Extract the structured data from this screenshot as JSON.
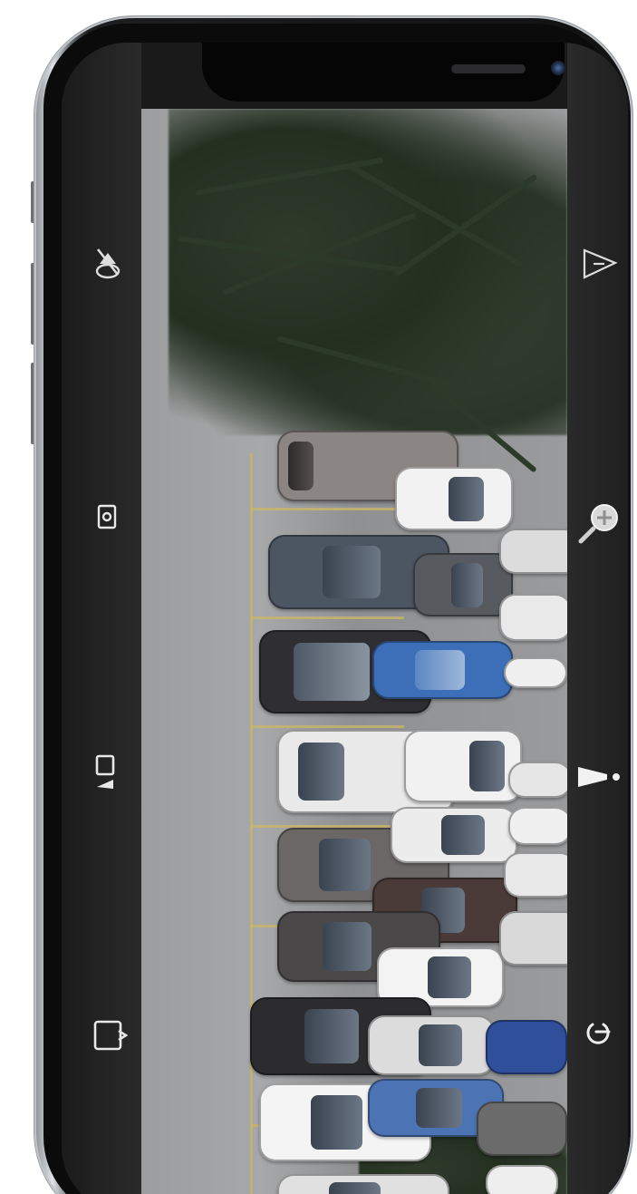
{
  "device": {
    "type": "smartphone",
    "orientation": "landscape-ui-in-portrait-frame"
  },
  "video": {
    "scene": "parking-lot-aerial"
  },
  "controls": {
    "left": [
      {
        "name": "audio-off-icon"
      },
      {
        "name": "snapshot-icon"
      },
      {
        "name": "record-icon"
      },
      {
        "name": "exit-fullscreen-icon"
      }
    ],
    "right": [
      {
        "name": "alarm-icon"
      },
      {
        "name": "zoom-in-icon"
      },
      {
        "name": "speaker-talk-icon"
      },
      {
        "name": "power-icon"
      }
    ]
  },
  "colors": {
    "control_strip": "#222222",
    "icon": "#e8e8e8"
  }
}
